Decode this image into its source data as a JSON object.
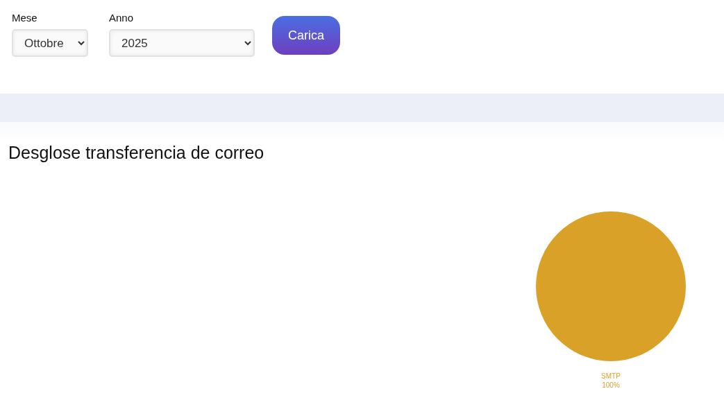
{
  "filters": [
    {
      "label": "Mese",
      "value": "Ottobre"
    },
    {
      "label": "Anno",
      "value": "2025"
    }
  ],
  "load_button": {
    "label": "Carica"
  },
  "section": {
    "title": "Desglose transferencia de correo",
    "chart_data": {
      "type": "pie",
      "categories": [
        "SMTP"
      ],
      "series": [
        {
          "color": "#daa128",
          "values": [
            100
          ]
        }
      ],
      "value_labels": [
        "100%"
      ]
    }
  }
}
